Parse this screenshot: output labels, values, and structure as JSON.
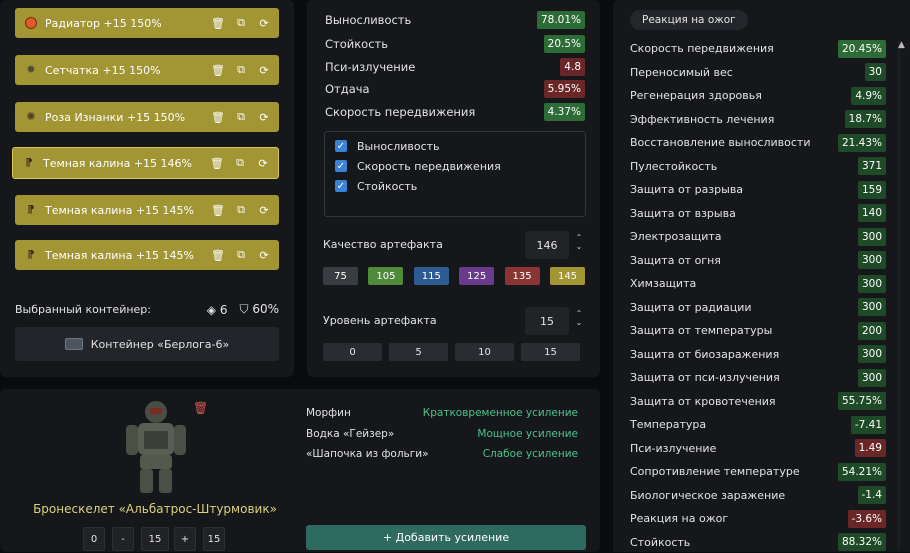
{
  "artifacts": [
    {
      "icon": "radiator-icon",
      "label": "Радиатор +15 150%"
    },
    {
      "icon": "net-icon",
      "label": "Сетчатка +15 150%"
    },
    {
      "icon": "rose-icon",
      "label": "Роза Изнанки +15 150%"
    },
    {
      "icon": "kalina-icon",
      "label": "Темная калина +15 146%"
    },
    {
      "icon": "kalina-icon",
      "label": "Темная калина +15 145%"
    },
    {
      "icon": "kalina-icon",
      "label": "Темная калина +15 145%"
    }
  ],
  "container": {
    "selected_label": "Выбранный контейнер:",
    "slots": "6",
    "protection": "60%",
    "name": "Контейнер «Берлога-6»"
  },
  "artifact_stats": [
    {
      "name": "Выносливость",
      "value": "78.01%",
      "tone": "green"
    },
    {
      "name": "Стойкость",
      "value": "20.5%",
      "tone": "green"
    },
    {
      "name": "Пси-излучение",
      "value": "4.8",
      "tone": "red"
    },
    {
      "name": "Отдача",
      "value": "5.95%",
      "tone": "red"
    },
    {
      "name": "Скорость передвижения",
      "value": "4.37%",
      "tone": "green"
    }
  ],
  "checkboxes": [
    "Выносливость",
    "Скорость передвижения",
    "Стойкость"
  ],
  "quality": {
    "label": "Качество артефакта",
    "value": "146",
    "presets": [
      {
        "label": "75",
        "color": "#3a3c41"
      },
      {
        "label": "105",
        "color": "#4f8a3a"
      },
      {
        "label": "115",
        "color": "#2f5b94"
      },
      {
        "label": "125",
        "color": "#6a3a8c"
      },
      {
        "label": "135",
        "color": "#8b3434"
      },
      {
        "label": "145",
        "color": "#a29533"
      }
    ]
  },
  "level": {
    "label": "Уровень артефакта",
    "value": "15",
    "presets": [
      "0",
      "5",
      "10",
      "15"
    ]
  },
  "right_panel": {
    "header": "Реакция на ожог",
    "stats": [
      {
        "name": "Скорость передвижения",
        "value": "20.45%",
        "tone": "green"
      },
      {
        "name": "Переносимый вес",
        "value": "30",
        "tone": "dgreen"
      },
      {
        "name": "Регенерация здоровья",
        "value": "4.9%",
        "tone": "dgreen"
      },
      {
        "name": "Эффективность лечения",
        "value": "18.7%",
        "tone": "dgreen"
      },
      {
        "name": "Восстановление выносливости",
        "value": "21.43%",
        "tone": "dgreen"
      },
      {
        "name": "Пулестойкость",
        "value": "371",
        "tone": "dgreen"
      },
      {
        "name": "Защита от разрыва",
        "value": "159",
        "tone": "dgreen"
      },
      {
        "name": "Защита от взрыва",
        "value": "140",
        "tone": "dgreen"
      },
      {
        "name": "Электрозащита",
        "value": "300",
        "tone": "dgreen"
      },
      {
        "name": "Защита от огня",
        "value": "300",
        "tone": "dgreen"
      },
      {
        "name": "Химзащита",
        "value": "300",
        "tone": "dgreen"
      },
      {
        "name": "Защита от радиации",
        "value": "300",
        "tone": "dgreen"
      },
      {
        "name": "Защита от температуры",
        "value": "200",
        "tone": "dgreen"
      },
      {
        "name": "Защита от биозаражения",
        "value": "300",
        "tone": "dgreen"
      },
      {
        "name": "Защита от пси-излучения",
        "value": "300",
        "tone": "dgreen"
      },
      {
        "name": "Защита от кровотечения",
        "value": "55.75%",
        "tone": "dgreen"
      },
      {
        "name": "Температура",
        "value": "-7.41",
        "tone": "dgreen"
      },
      {
        "name": "Пси-излучение",
        "value": "1.49",
        "tone": "red"
      },
      {
        "name": "Сопротивление температуре",
        "value": "54.21%",
        "tone": "dgreen"
      },
      {
        "name": "Биологическое заражение",
        "value": "-1.4",
        "tone": "dgreen"
      },
      {
        "name": "Реакция на ожог",
        "value": "-3.6%",
        "tone": "red"
      },
      {
        "name": "Стойкость",
        "value": "88.32%",
        "tone": "dgreen"
      }
    ]
  },
  "armor": {
    "name": "Бронескелет «Альбатрос-Штурмовик»",
    "stepper": [
      "0",
      "-",
      "15",
      "+",
      "15"
    ]
  },
  "boosts": [
    {
      "name": "Морфин",
      "effect": "Кратковременное усиление"
    },
    {
      "name": "Водка «Гейзер»",
      "effect": "Мощное усиление"
    },
    {
      "name": "«Шапочка из фольги»",
      "effect": "Слабое усиление"
    }
  ],
  "add_boost_label": "+ Добавить усиление"
}
